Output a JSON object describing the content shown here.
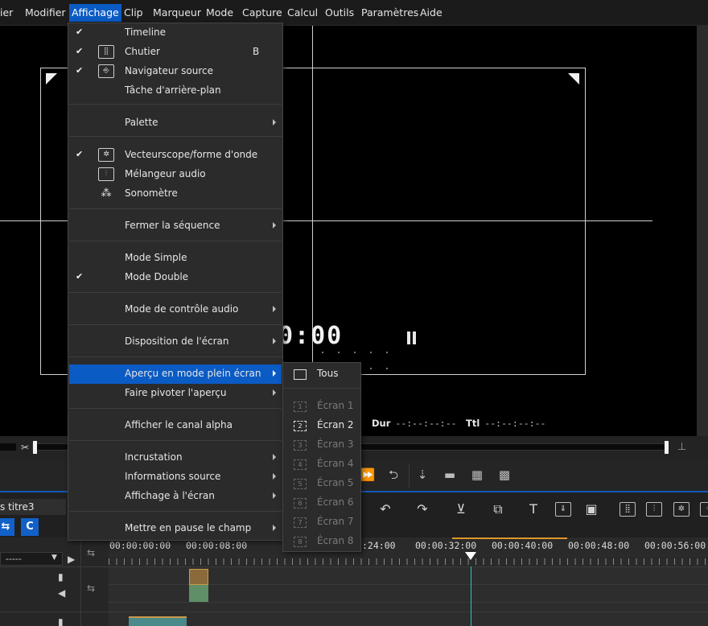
{
  "menubar": {
    "items": [
      {
        "label": "ier"
      },
      {
        "label": "Modifier"
      },
      {
        "label": "Affichage"
      },
      {
        "label": "Clip"
      },
      {
        "label": "Marqueur"
      },
      {
        "label": "Mode"
      },
      {
        "label": "Capture"
      },
      {
        "label": "Calcul"
      },
      {
        "label": "Outils"
      },
      {
        "label": "Paramètres"
      },
      {
        "label": "Aide"
      }
    ],
    "active_index": 2
  },
  "preview": {
    "timecode": "0:00",
    "dur_label": "Dur",
    "dur_value": "--:--:--:--",
    "ttl_label": "Ttl",
    "ttl_value": "--:--:--:--"
  },
  "menu": {
    "items": [
      {
        "label": "Timeline",
        "checked": true,
        "icon": ""
      },
      {
        "label": "Chutier",
        "checked": true,
        "icon": "bin-icon",
        "shortcut": "B"
      },
      {
        "label": "Navigateur source",
        "checked": true,
        "icon": "usb-icon"
      },
      {
        "label": "Tâche d'arrière-plan",
        "checked": false,
        "icon": ""
      },
      {
        "label": "Palette",
        "checked": false,
        "submenu": true
      },
      {
        "label": "Vecteurscope/forme d'onde",
        "checked": true,
        "icon": "vectorscope-icon"
      },
      {
        "label": "Mélangeur audio",
        "checked": false,
        "icon": "audio-mixer-icon"
      },
      {
        "label": "Sonomètre",
        "checked": false,
        "icon": "sound-meter-icon"
      },
      {
        "label": "Fermer la séquence",
        "submenu": true
      },
      {
        "label": "Mode Simple"
      },
      {
        "label": "Mode Double",
        "checked": true
      },
      {
        "label": "Mode de contrôle audio",
        "submenu": true
      },
      {
        "label": "Disposition de l'écran",
        "submenu": true
      },
      {
        "label": "Aperçu en mode plein écran",
        "submenu": true,
        "highlighted": true
      },
      {
        "label": "Faire pivoter l'aperçu",
        "submenu": true
      },
      {
        "label": "Afficher le canal alpha"
      },
      {
        "label": "Incrustation",
        "submenu": true
      },
      {
        "label": "Informations source",
        "submenu": true
      },
      {
        "label": "Affichage à l'écran",
        "submenu": true
      },
      {
        "label": "Mettre en pause le champ",
        "submenu": true
      }
    ]
  },
  "submenu": {
    "items": [
      {
        "label": "Tous",
        "icon": "fullscreen-all-icon",
        "enabled": true
      },
      {
        "label": "Écran 1",
        "num": "1",
        "enabled": false
      },
      {
        "label": "Écran 2",
        "num": "2",
        "enabled": true
      },
      {
        "label": "Écran 3",
        "num": "3",
        "enabled": false
      },
      {
        "label": "Écran 4",
        "num": "4",
        "enabled": false
      },
      {
        "label": "Écran 5",
        "num": "5",
        "enabled": false
      },
      {
        "label": "Écran 6",
        "num": "6",
        "enabled": false
      },
      {
        "label": "Écran 7",
        "num": "7",
        "enabled": false
      },
      {
        "label": "Écran 8",
        "num": "8",
        "enabled": false
      }
    ]
  },
  "timeline": {
    "sequence_tab": "s titre3",
    "track_select": "-----",
    "ruler": [
      "00:00:00:00",
      "00:00:08:00",
      ":24:00",
      "00:00:32:00",
      "00:00:40:00",
      "00:00:48:00",
      "00:00:56:00"
    ]
  },
  "colors": {
    "accent": "#0b5bc5",
    "playhead": "#2ec4c4",
    "range": "#e0952a"
  }
}
